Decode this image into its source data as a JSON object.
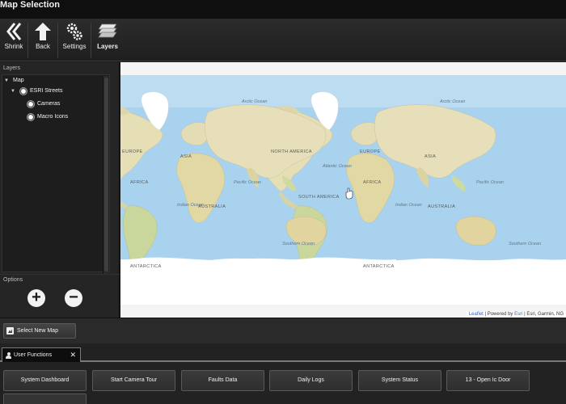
{
  "window": {
    "title": "Map Selection"
  },
  "toolbar": {
    "buttons": [
      {
        "label": "Shrink",
        "icon": "double-chevron-left-icon"
      },
      {
        "label": "Back",
        "icon": "up-arrow-icon"
      },
      {
        "label": "Settings",
        "icon": "gears-icon"
      },
      {
        "label": "Layers",
        "icon": "layers-stack-icon"
      }
    ]
  },
  "layers_panel": {
    "heading": "Layers",
    "tree": [
      {
        "label": "Map",
        "level": 0
      },
      {
        "label": "ESRI Streets",
        "level": 1
      },
      {
        "label": "Cameras",
        "level": 2
      },
      {
        "label": "Macro Icons",
        "level": 2
      }
    ],
    "options_heading": "Options"
  },
  "map": {
    "labels": {
      "arctic_ocean": "Arctic Ocean",
      "north_america": "NORTH AMERICA",
      "europe": "EUROPE",
      "asia": "ASIA",
      "africa": "AFRICA",
      "south_america": "SOUTH AMERICA",
      "australia": "AUSTRALIA",
      "antarctica": "ANTARCTICA",
      "pacific_ocean": "Pacific Ocean",
      "atlantic_ocean": "Atlantic Ocean",
      "indian_ocean": "Indian Ocean",
      "southern_ocean": "Southern Ocean"
    },
    "attribution": {
      "leaflet": "Leaflet",
      "powered": " | Powered by ",
      "esri": "Esri",
      "rest": " | Esri, Garmin, NG"
    }
  },
  "select_map_button": "Select New Map",
  "user_functions": {
    "tab_label": "User Functions",
    "close_glyph": "✕",
    "buttons": [
      "System Dashboard",
      "Start Camera Tour",
      "Faults Data",
      "Daily Logs",
      "System Status",
      "13 - Open Ic Door"
    ]
  },
  "colors": {
    "ocean": "#a9d2ee",
    "land": "#e9e2bf",
    "ice": "#ffffff",
    "toolbar_bg": "#262626"
  }
}
